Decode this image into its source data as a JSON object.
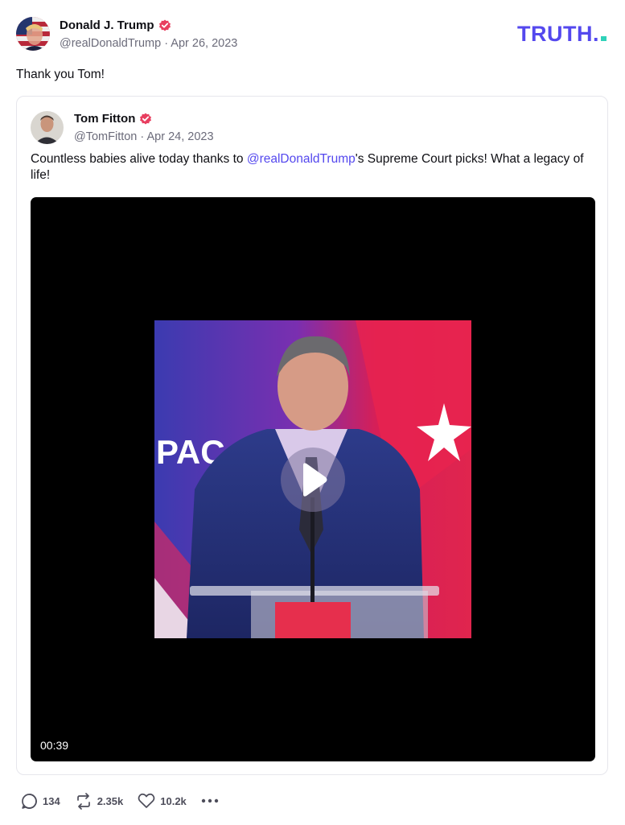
{
  "post": {
    "author": {
      "name": "Donald J. Trump",
      "handle": "@realDonaldTrump",
      "date": "Apr 26, 2023",
      "verified_icon": "verified-badge-icon"
    },
    "meta_separator": " · ",
    "brand": {
      "logo_text": "TRUTH.",
      "accent_color": "#5448ee",
      "dot_color": "#2fd2b9"
    },
    "text": "Thank you Tom!",
    "quote": {
      "author": {
        "name": "Tom Fitton",
        "handle": "@TomFitton",
        "date": "Apr 24, 2023"
      },
      "text_before": "Countless babies alive today thanks to ",
      "mention": "@realDonaldTrump",
      "text_after": "'s Supreme Court picks!  What a legacy of life!",
      "video": {
        "duration": "00:39",
        "stage_sign_text": "PAC",
        "play_icon": "play-icon"
      }
    },
    "actions": {
      "replies": "134",
      "retruths": "2.35k",
      "likes": "10.2k",
      "icons": [
        "reply-icon",
        "retruth-icon",
        "heart-icon",
        "more-icon"
      ]
    },
    "colors": {
      "verified": "#e83e5f",
      "mention": "#5448ee",
      "muted": "#6b6b7a"
    }
  }
}
